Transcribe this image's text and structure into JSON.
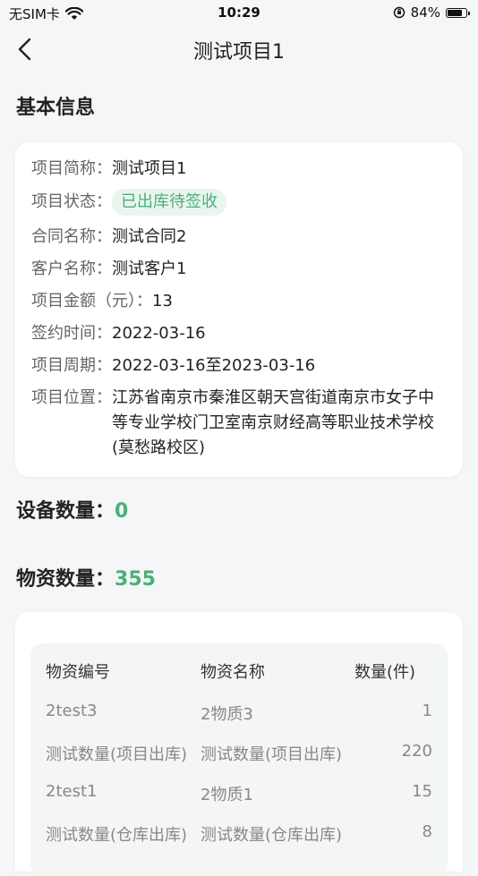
{
  "status_bar": {
    "carrier": "无SIM卡",
    "time": "10:29",
    "battery": "84%",
    "battery_level": 0.84
  },
  "nav": {
    "title": "测试项目1"
  },
  "basic_info": {
    "section_title": "基本信息",
    "rows": [
      {
        "label": "项目简称：",
        "value": "测试项目1"
      },
      {
        "label": "项目状态：",
        "value": "已出库待签收"
      },
      {
        "label": "合同名称：",
        "value": "测试合同2"
      },
      {
        "label": "客户名称：",
        "value": "测试客户1"
      },
      {
        "label": "项目金额（元）：",
        "value": "13"
      },
      {
        "label": "签约时间：",
        "value": "2022-03-16"
      },
      {
        "label": "项目周期：",
        "value": "2022-03-16至2023-03-16"
      },
      {
        "label": "项目位置：",
        "value": "江苏省南京市秦淮区朝天宫街道南京市女子中等专业学校门卫室南京财经高等职业技术学校(莫愁路校区)"
      }
    ]
  },
  "device_count": {
    "label": "设备数量：",
    "value": "0"
  },
  "material_count": {
    "label": "物资数量：",
    "value": "355"
  },
  "material_table": {
    "headers": [
      "物资编号",
      "物资名称",
      "数量(件)"
    ],
    "rows": [
      [
        "2test3",
        "2物质3",
        "1"
      ],
      [
        "测试数量(项目出库)",
        "测试数量(项目出库)",
        "220"
      ],
      [
        "2test1",
        "2物质1",
        "15"
      ],
      [
        "测试数量(仓库出库)",
        "测试数量(仓库出库)",
        "8"
      ]
    ]
  }
}
